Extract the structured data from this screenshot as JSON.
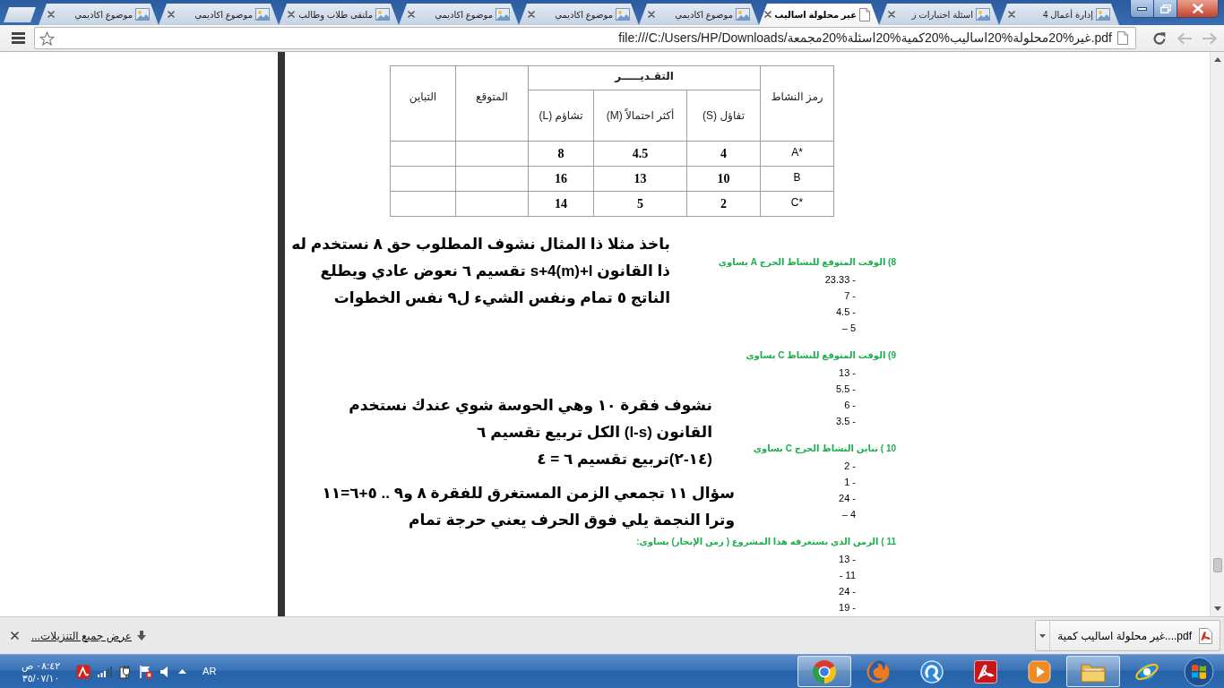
{
  "browser": {
    "tabs": [
      {
        "title": "إدارة أعمال 4",
        "kind": "site",
        "selected": false
      },
      {
        "title": "اسئلة اختبارات ز",
        "kind": "site",
        "selected": false
      },
      {
        "title": "غير محلولة اساليب",
        "kind": "file",
        "selected": true
      },
      {
        "title": "موضوع اكاديمي",
        "kind": "site",
        "selected": false
      },
      {
        "title": "موضوع اكاديمي",
        "kind": "site",
        "selected": false
      },
      {
        "title": "موضوع اكاديمي",
        "kind": "site",
        "selected": false
      },
      {
        "title": "ملتقى طلاب وطالب",
        "kind": "site",
        "selected": false
      },
      {
        "title": "موضوع اكاديمي",
        "kind": "site",
        "selected": false
      },
      {
        "title": "موضوع اكاديمي",
        "kind": "site",
        "selected": false
      }
    ],
    "address": "file:///C:/Users/HP/Downloads/غير%20محلولة%20اساليب%20كمية%20اسئلة%20مجمعة.pdf",
    "nav_buttons": [
      {
        "kind": "reload",
        "disabled": false
      },
      {
        "kind": "back",
        "disabled": true
      },
      {
        "kind": "forward",
        "disabled": true
      }
    ]
  },
  "document": {
    "table": {
      "columns": [
        {
          "label": "رمز النشاط"
        },
        {
          "label": "التقـديـــــر",
          "subcolumns": [
            "تفاؤل (S)",
            "أكثر احتمالاً (M)",
            "تشاؤم (L)"
          ]
        },
        {
          "label": "المتوقع"
        },
        {
          "label": "التباين"
        }
      ],
      "rows": [
        {
          "code": "A*",
          "estimates": [
            "4",
            "4.5",
            "8"
          ]
        },
        {
          "code": "B",
          "estimates": [
            "10",
            "13",
            "16"
          ]
        },
        {
          "code": "C*",
          "estimates": [
            "2",
            "5",
            "14"
          ]
        }
      ]
    },
    "questions": [
      {
        "title": "8) الوقت المتوقع للنشاط الحرج A يساوي",
        "options": [
          "- 23.33",
          "- 7",
          "- 4.5",
          "5 –"
        ]
      },
      {
        "title": "9) الوقت المتوقع للنشاط C يساوي",
        "options": [
          "- 13",
          "- 5.5",
          "- 6",
          "- 3.5"
        ]
      },
      {
        "title": "10 ) تباين النشاط الحرج C يساوي",
        "options": [
          "- 2",
          "- 1",
          "- 24",
          "4 –"
        ]
      },
      {
        "title": "11 ) الزمن الذي يستغرقه هذا المشروع ( زمن الإنجاز) يساوي:",
        "options": [
          "- 13",
          "11 -",
          "- 24",
          "- 19"
        ]
      }
    ],
    "notes": [
      {
        "lines": [
          "باخذ مثلا ذا المثال نشوف المطلوب حق ٨ نستخدم له",
          "ذا القانون s+4(m)+l تقسيم ٦ نعوض عادي ويطلع",
          "الناتج ٥ تمام ونفس الشيء ل٩ نفس الخطوات"
        ]
      },
      {
        "lines": [
          "نشوف فقرة ١٠ وهي الحوسة شوي عندك نستخدم",
          "القانون (l-s) الكل تربيع تقسيم ٦",
          "(١٤-٢)تربيع تقسيم ٦ = ٤"
        ]
      },
      {
        "lines": [
          "سؤال ١١ تجمعي الزمن المستغرق للفقرة ٨ و٩ .. ٥+٦=١١",
          "وترا النجمة يلي فوق الحرف يعني حرجة تمام"
        ]
      }
    ]
  },
  "download_bar": {
    "file": "غير محلولة اساليب كمية....pdf",
    "show_all": "عرض جميع التنزيلات..."
  },
  "taskbar": {
    "apps": [
      {
        "kind": "orbit",
        "active": false
      },
      {
        "kind": "folder",
        "active": true
      },
      {
        "kind": "media",
        "active": false
      },
      {
        "kind": "reader",
        "active": false
      },
      {
        "kind": "disc",
        "active": false
      },
      {
        "kind": "globe",
        "active": false
      },
      {
        "kind": "sphere",
        "active": true
      }
    ],
    "tray": {
      "language": "AR",
      "time": "٠٨:٤٢ ص",
      "date": "٣٥/٠٧/١٠"
    }
  }
}
